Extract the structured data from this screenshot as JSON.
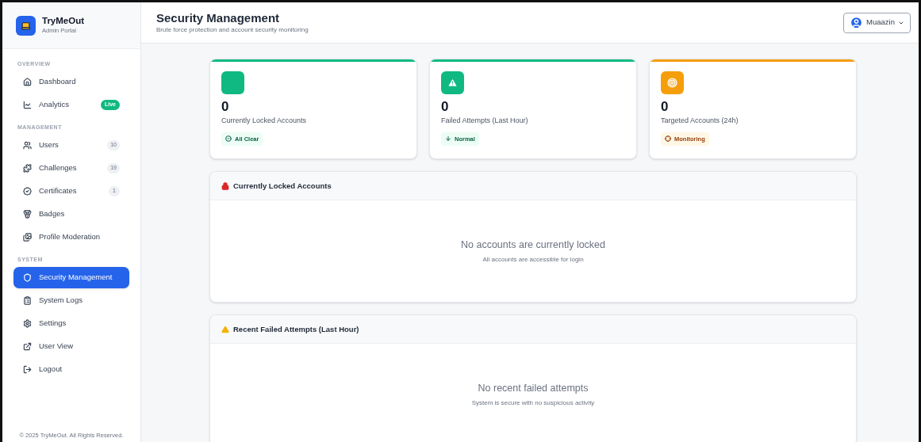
{
  "brand": {
    "name": "TryMeOut",
    "subtitle": "Admin Portal"
  },
  "sidebar": {
    "sections": [
      {
        "title": "OVERVIEW",
        "items": [
          {
            "label": "Dashboard",
            "selected": false
          },
          {
            "label": "Analytics",
            "selected": false,
            "badge": "Live",
            "kind": "live"
          }
        ]
      },
      {
        "title": "MANAGEMENT",
        "items": [
          {
            "label": "Users",
            "selected": false,
            "badge": "10",
            "kind": "count"
          },
          {
            "label": "Challenges",
            "selected": false,
            "badge": "19",
            "kind": "count"
          },
          {
            "label": "Certificates",
            "selected": false,
            "badge": "1",
            "kind": "count"
          },
          {
            "label": "Badges",
            "selected": false
          },
          {
            "label": "Profile Moderation",
            "selected": false
          }
        ]
      },
      {
        "title": "SYSTEM",
        "items": [
          {
            "label": "Security Management",
            "selected": true
          },
          {
            "label": "System Logs",
            "selected": false
          },
          {
            "label": "Settings",
            "selected": false
          },
          {
            "label": "User View",
            "selected": false
          },
          {
            "label": "Logout",
            "selected": false
          }
        ]
      }
    ],
    "footer": "© 2025 TryMeOut. All Rights Reserved."
  },
  "header": {
    "title": "Security Management",
    "subtitle": "Brute force protection and account security monitoring",
    "user": "Muaazin"
  },
  "stats": [
    {
      "value": "0",
      "label": "Currently Locked Accounts",
      "status": "All Clear",
      "color": "#10b981"
    },
    {
      "value": "0",
      "label": "Failed Attempts (Last Hour)",
      "status": "Normal",
      "color": "#10b981"
    },
    {
      "value": "0",
      "label": "Targeted Accounts (24h)",
      "status": "Monitoring",
      "color": "#f59e0b"
    }
  ],
  "panels": [
    {
      "title": "Currently Locked Accounts",
      "empty_title": "No accounts are currently locked",
      "empty_text": "All accounts are accessible for login"
    },
    {
      "title": "Recent Failed Attempts (Last Hour)",
      "empty_title": "No recent failed attempts",
      "empty_text": "System is secure with no suspicious activity"
    }
  ]
}
